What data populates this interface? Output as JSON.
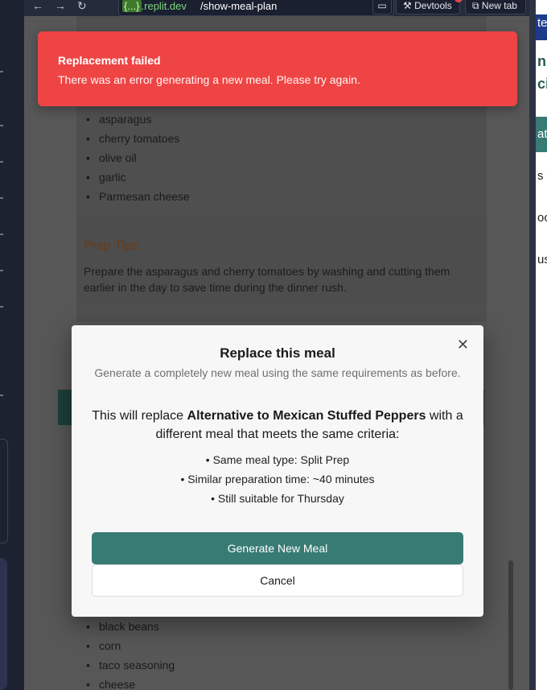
{
  "browser": {
    "url_prefix_brace": "{...}",
    "url_domain": ".replit.dev",
    "url_path": "/show-meal-plan",
    "devtools_label": "Devtools",
    "newtab_label": "New tab"
  },
  "meal_card": {
    "ingredients_top": [
      "asparagus",
      "cherry tomatoes",
      "olive oil",
      "garlic",
      "Parmesan cheese"
    ],
    "prep_tips_title": "Prep Tips:",
    "prep_tips_text": "Prepare the asparagus and cherry tomatoes by washing and cutting them earlier in the day to save time during the dinner rush.",
    "ingredients_bottom": [
      "black beans",
      "corn",
      "taco seasoning",
      "cheese"
    ]
  },
  "right_panel": {
    "fragments": [
      "te",
      "nr",
      "ci",
      "at",
      "s V",
      "oc",
      "us"
    ]
  },
  "toast": {
    "title": "Replacement failed",
    "message": "There was an error generating a new meal. Please try again."
  },
  "modal": {
    "title": "Replace this meal",
    "subtitle": "Generate a completely new meal using the same requirements as before.",
    "body_prefix": "This will replace ",
    "meal_name": "Alternative to Mexican Stuffed Peppers",
    "body_suffix": " with a different meal that meets the same criteria:",
    "criteria": [
      "• Same meal type: Split Prep",
      "• Similar preparation time: ~40 minutes",
      "• Still suitable for Thursday"
    ],
    "generate_label": "Generate New Meal",
    "cancel_label": "Cancel"
  },
  "colors": {
    "toast_bg": "#ef4444",
    "primary_button": "#387b74"
  }
}
